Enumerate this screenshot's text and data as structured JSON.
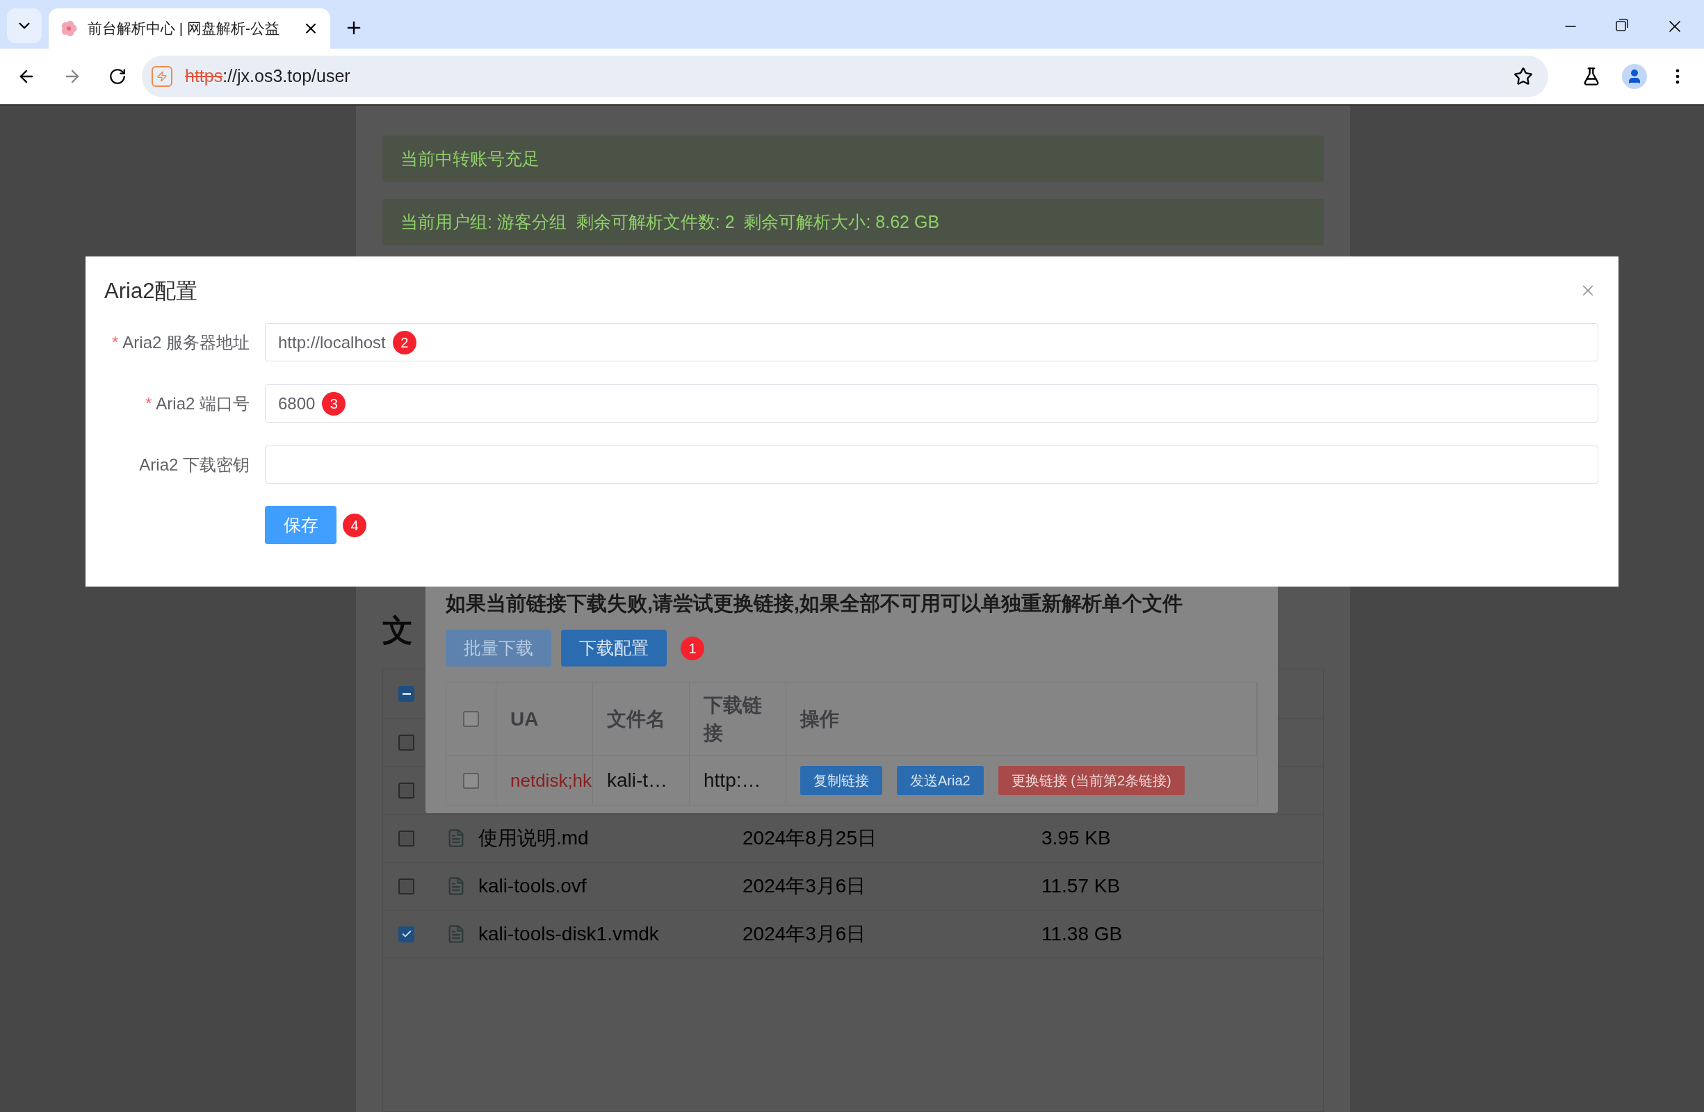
{
  "browser": {
    "tab": {
      "title": "前台解析中心 | 网盘解析-公益"
    },
    "address": {
      "scheme": "https",
      "rest": "://jx.os3.top/user",
      "insecure": true
    }
  },
  "page": {
    "alerts": [
      "当前中转账号充足",
      "当前用户组: 游客分组  剩余可解析文件数: 2  剩余可解析大小: 8.62 GB"
    ],
    "files_heading": "文",
    "file_table": {
      "header_checkbox": {
        "indeterminate": true
      },
      "rows": [
        {
          "checked": false
        },
        {
          "checked": false
        },
        {
          "checked": false,
          "name": "使用说明.md",
          "date": "2024年8月25日",
          "size": "3.95 KB"
        },
        {
          "checked": false,
          "name": "kali-tools.ovf",
          "date": "2024年3月6日",
          "size": "11.57 KB"
        },
        {
          "checked": true,
          "name": "kali-tools-disk1.vmdk",
          "date": "2024年3月6日",
          "size": "11.38 GB"
        }
      ]
    }
  },
  "links_dialog": {
    "notice": "如果当前链接下载失败,请尝试更换链接,如果全部不可用可以单独重新解析单个文件",
    "buttons": [
      {
        "label": "批量下载",
        "disabled": true
      },
      {
        "label": "下载配置",
        "disabled": false,
        "badge": "1"
      }
    ],
    "header_checkbox": {
      "checked": false
    },
    "columns": [
      "UA",
      "文件名",
      "下载链接",
      "操作"
    ],
    "rows": [
      {
        "checked": false,
        "ua": "netdisk;hk",
        "file": "kali-t…",
        "link": "http:…",
        "actions": [
          {
            "label": "复制链接",
            "kind": "primary"
          },
          {
            "label": "发送Aria2",
            "kind": "primary"
          },
          {
            "label": "更换链接 (当前第2条链接)",
            "kind": "danger"
          }
        ]
      }
    ]
  },
  "aria_dialog": {
    "title": "Aria2配置",
    "required_mark": "*",
    "fields": [
      {
        "label": "Aria2 服务器地址",
        "required": true,
        "value": "http://localhost",
        "badge": "2"
      },
      {
        "label": "Aria2 端口号",
        "required": true,
        "value": "6800",
        "badge": "3"
      },
      {
        "label": "Aria2 下载密钥",
        "required": false
      }
    ],
    "save": {
      "label": "保存",
      "badge": "4"
    }
  }
}
